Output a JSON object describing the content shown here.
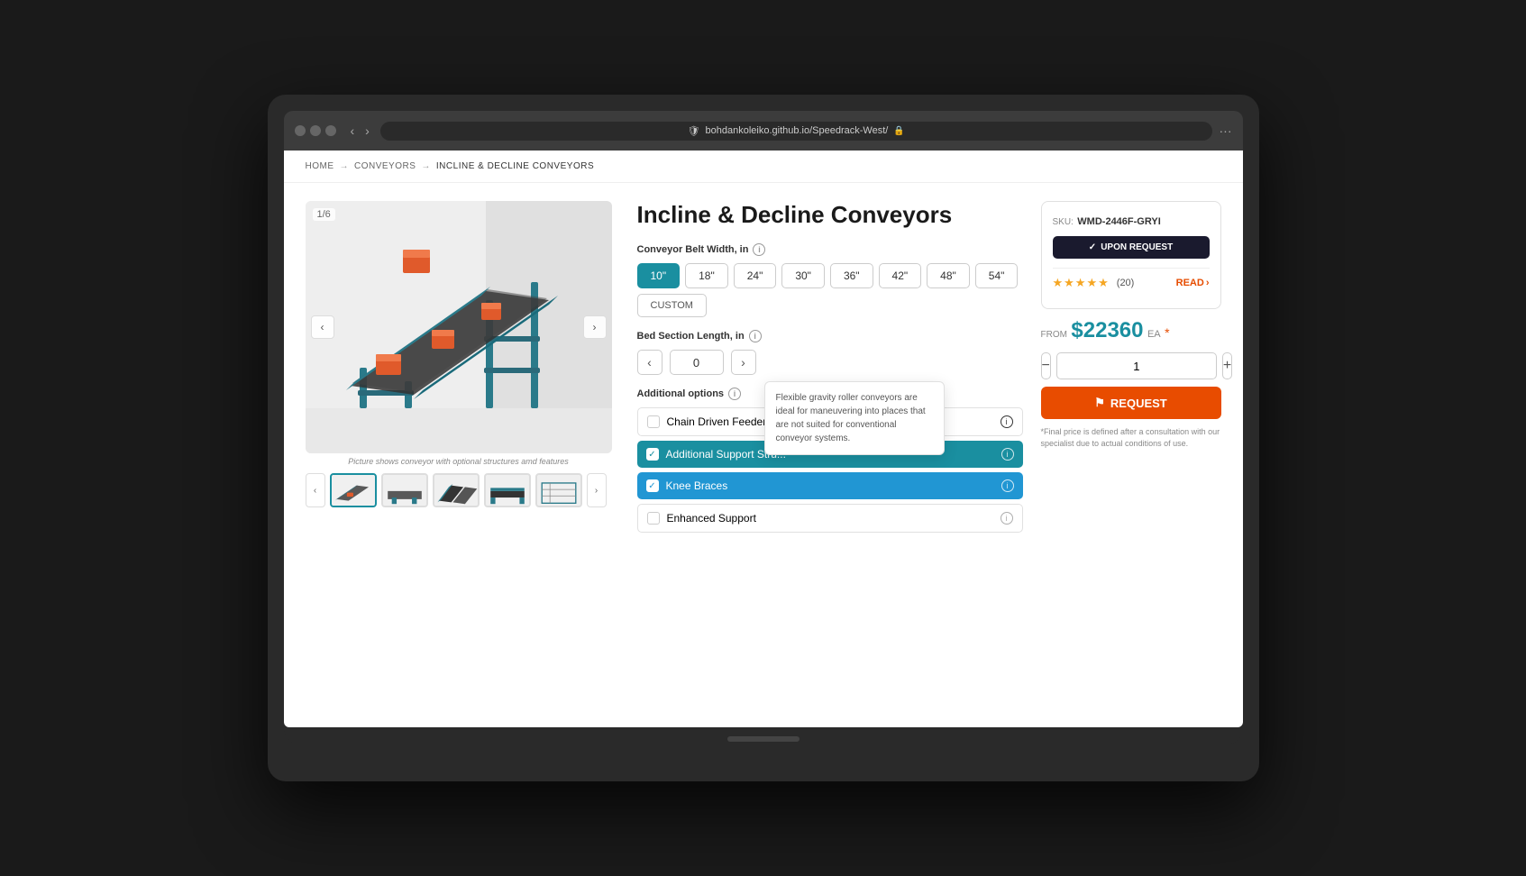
{
  "browser": {
    "url": "bohdankoleiko.github.io/Speedrack-West/",
    "shield_icon": "🛡"
  },
  "breadcrumb": {
    "home": "HOME",
    "arrow1": "→",
    "conveyors": "CONVEYORS",
    "arrow2": "→",
    "current": "INCLINE & DECLINE CONVEYORS"
  },
  "product": {
    "title": "Incline & Decline Conveyors",
    "image_counter": "1/6",
    "image_caption": "Picture shows conveyor with optional structures amd features"
  },
  "belt_width": {
    "label": "Conveyor Belt Width, in",
    "options": [
      "10\"",
      "18\"",
      "24\"",
      "30\"",
      "36\"",
      "42\"",
      "48\"",
      "54\"",
      "CUSTOM"
    ],
    "active": "10\""
  },
  "bed_section": {
    "label": "Bed Section Length, in",
    "value": "0"
  },
  "additional_options": {
    "label": "Additional options",
    "items": [
      {
        "id": "chain-driven",
        "label": "Chain Driven Feeder",
        "checked": false,
        "style": "unchecked"
      },
      {
        "id": "additional-support",
        "label": "Additional Support Structures",
        "checked": true,
        "style": "checked-teal"
      },
      {
        "id": "knee-braces",
        "label": "Knee Braces",
        "checked": true,
        "style": "checked-blue"
      },
      {
        "id": "enhanced-support",
        "label": "Enhanced Support",
        "checked": false,
        "style": "unchecked"
      }
    ]
  },
  "tooltip": {
    "text": "Flexible gravity roller conveyors are ideal for maneuvering into places that are not suited for conventional conveyor systems."
  },
  "sku": {
    "label": "SKU:",
    "value": "WMD-2446F-GRYI"
  },
  "upon_request": {
    "label": "UPON REQUEST",
    "check_icon": "✓"
  },
  "rating": {
    "stars": "★★★★★",
    "count": "(20)",
    "read_label": "READ",
    "read_arrow": "›"
  },
  "price": {
    "from_label": "FROM",
    "amount": "$22360",
    "unit": "EA",
    "asterisk": "*"
  },
  "quantity": {
    "value": "1",
    "minus": "−",
    "plus": "+"
  },
  "request_btn": {
    "label": "REQUEST",
    "icon": "⚑"
  },
  "final_note": "*Final price is defined after a consultation with our specialist due to actual conditions of use.",
  "thumbnails": [
    {
      "id": "thumb-1",
      "active": true
    },
    {
      "id": "thumb-2",
      "active": false
    },
    {
      "id": "thumb-3",
      "active": false
    },
    {
      "id": "thumb-4",
      "active": false
    },
    {
      "id": "thumb-5",
      "active": false
    },
    {
      "id": "thumb-6",
      "active": false
    }
  ]
}
